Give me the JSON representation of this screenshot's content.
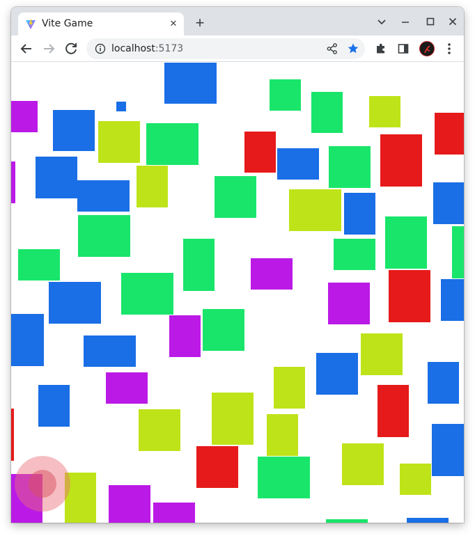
{
  "browser": {
    "tab_title": "Vite Game",
    "url_host": "localhost",
    "url_port": ":5173",
    "new_tab_label": "+",
    "close_tab_label": "✕"
  },
  "colors": {
    "blue": "#1a6ee6",
    "green": "#19e56a",
    "lime": "#bfe319",
    "red": "#e61a1a",
    "purple": "#bb1ae6",
    "star": "#1a73e8"
  },
  "game": {
    "boxes": [
      {
        "color": "blue"
      },
      {
        "color": "purple"
      },
      {
        "color": "blue"
      },
      {
        "color": "green"
      },
      {
        "color": "green"
      },
      {
        "color": "lime"
      },
      {
        "color": "red"
      },
      {
        "color": "blue"
      },
      {
        "color": "lime"
      },
      {
        "color": "green"
      },
      {
        "color": "red"
      },
      {
        "color": "blue"
      },
      {
        "color": "green"
      },
      {
        "color": "red"
      },
      {
        "color": "purple"
      },
      {
        "color": "blue"
      },
      {
        "color": "blue"
      },
      {
        "color": "lime"
      },
      {
        "color": "green"
      },
      {
        "color": "lime"
      },
      {
        "color": "blue"
      },
      {
        "color": "blue"
      },
      {
        "color": "green"
      },
      {
        "color": "green"
      },
      {
        "color": "green"
      },
      {
        "color": "green"
      },
      {
        "color": "green"
      },
      {
        "color": "purple"
      },
      {
        "color": "blue"
      },
      {
        "color": "green"
      },
      {
        "color": "purple"
      },
      {
        "color": "red"
      },
      {
        "color": "blue"
      },
      {
        "color": "blue"
      },
      {
        "color": "purple"
      },
      {
        "color": "green"
      },
      {
        "color": "green"
      },
      {
        "color": "blue"
      },
      {
        "color": "lime"
      },
      {
        "color": "blue"
      },
      {
        "color": "blue"
      },
      {
        "color": "purple"
      },
      {
        "color": "lime"
      },
      {
        "color": "blue"
      },
      {
        "color": "red"
      },
      {
        "color": "blue"
      },
      {
        "color": "lime"
      },
      {
        "color": "lime"
      },
      {
        "color": "red"
      },
      {
        "color": "lime"
      },
      {
        "color": "lime"
      },
      {
        "color": "blue"
      },
      {
        "color": "red"
      },
      {
        "color": "green"
      },
      {
        "color": "lime"
      },
      {
        "color": "lime"
      },
      {
        "color": "purple"
      },
      {
        "color": "lime"
      },
      {
        "color": "purple"
      },
      {
        "color": "purple"
      },
      {
        "color": "green"
      },
      {
        "color": "blue"
      }
    ]
  }
}
